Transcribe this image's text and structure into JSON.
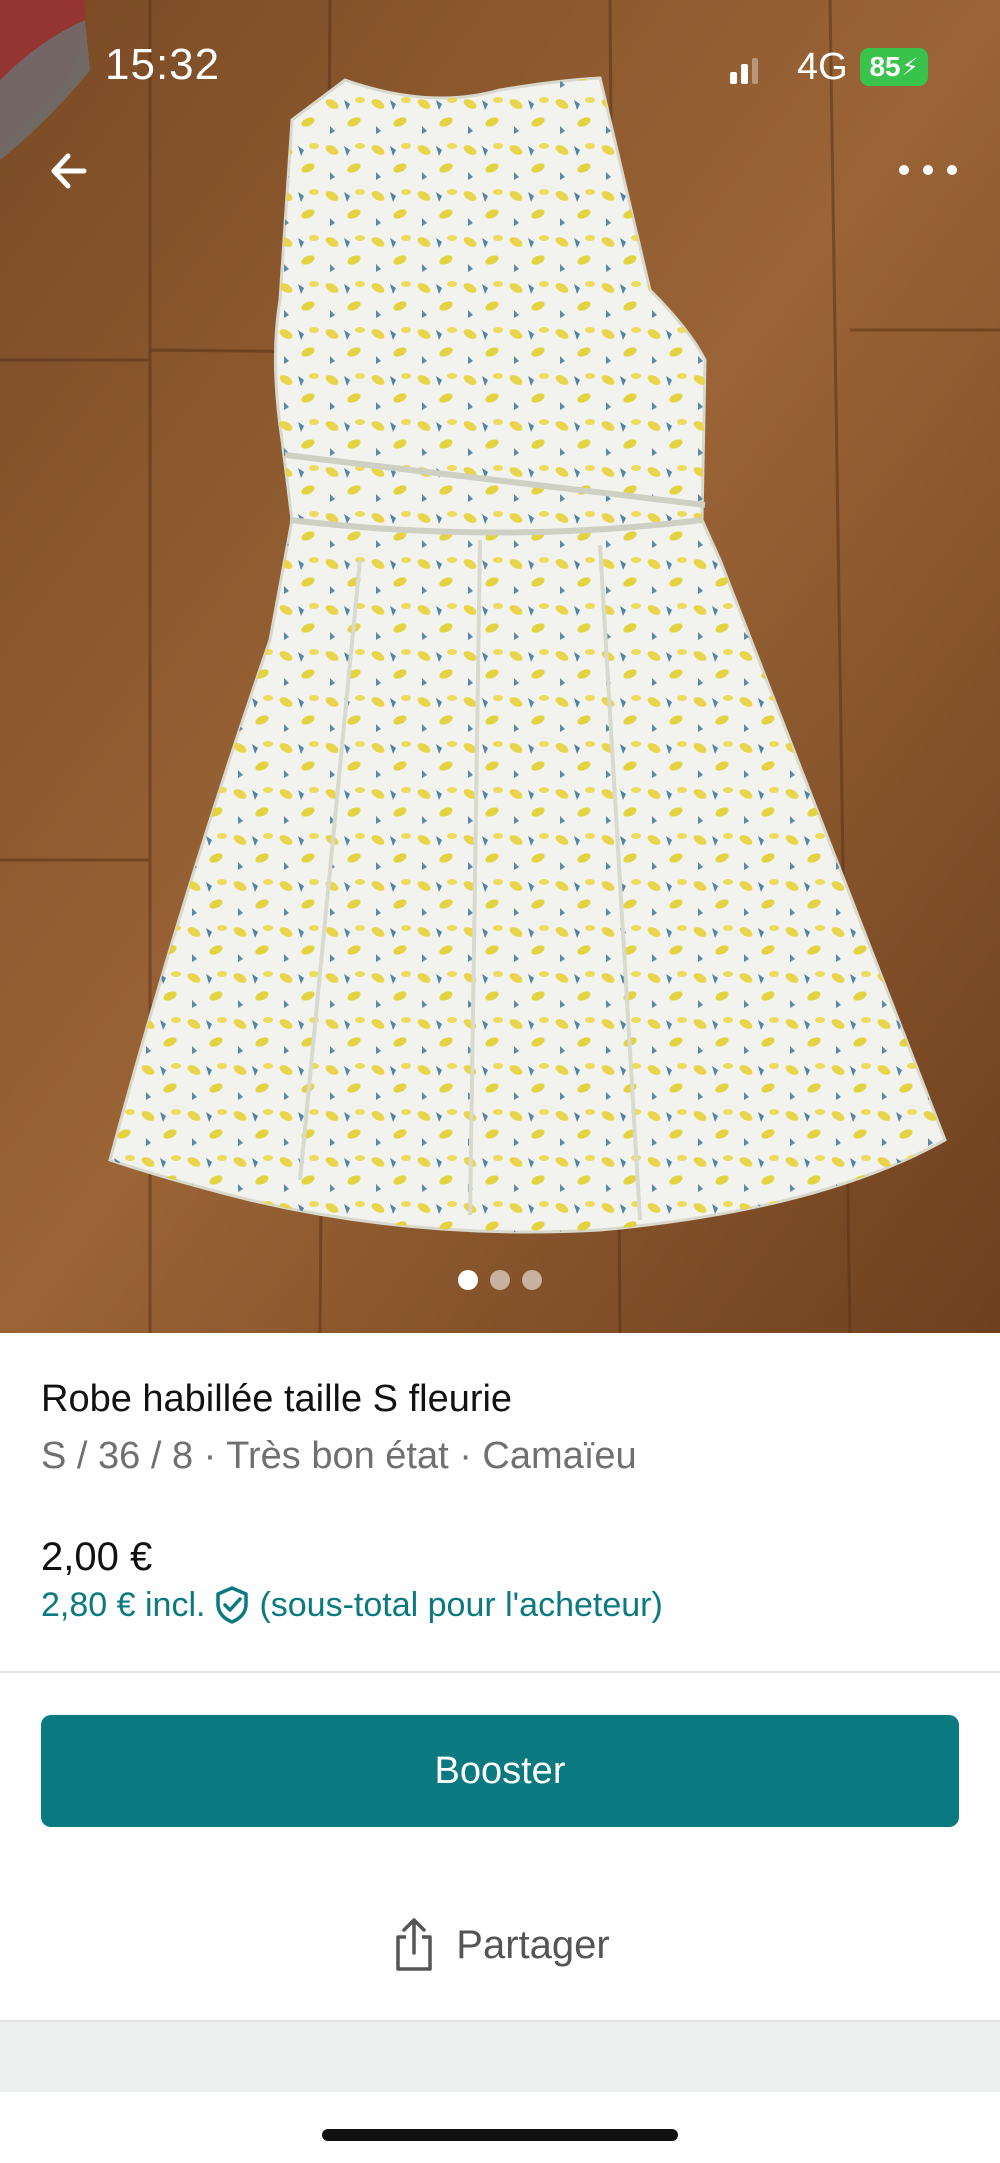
{
  "status_bar": {
    "time": "15:32",
    "network": "4G",
    "battery": "85"
  },
  "gallery": {
    "image_count": 3,
    "active_index": 0
  },
  "item": {
    "title": "Robe habillée taille S fleurie",
    "subtitle": "S / 36 / 8 · Très bon état · Camaïeu",
    "price": "2,00 €",
    "price_incl_prefix": "2,80 € incl.",
    "price_incl_suffix": "(sous-total pour l'acheteur)"
  },
  "actions": {
    "boost_label": "Booster",
    "share_label": "Partager"
  },
  "colors": {
    "accent": "#0b7a80",
    "link": "#0a7a80",
    "battery": "#3ac34c"
  },
  "icons": [
    "back-arrow-icon",
    "more-options-icon",
    "shield-check-icon",
    "share-icon"
  ]
}
